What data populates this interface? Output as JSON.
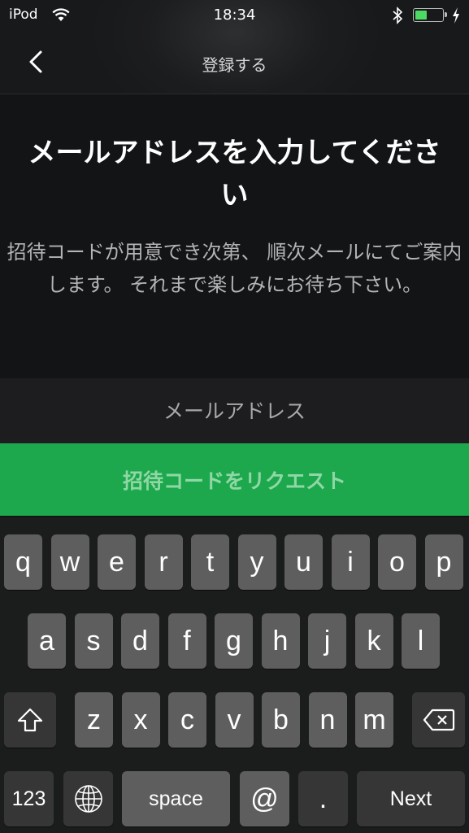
{
  "status_bar": {
    "carrier": "iPod",
    "time": "18:34",
    "battery_level_pct": 45,
    "icons": [
      "wifi-icon",
      "bluetooth-icon",
      "battery-icon",
      "charging-bolt-icon"
    ]
  },
  "nav": {
    "back_icon": "chevron-left-icon",
    "title": "登録する"
  },
  "content": {
    "heading": "メールアドレスを入力してください",
    "description": "招待コードが用意でき次第、 順次メールにてご案内します。 それまで楽しみにお待ち下さい。"
  },
  "form": {
    "email_value": "",
    "email_placeholder": "メールアドレス",
    "request_button_label": "招待コードをリクエスト"
  },
  "colors": {
    "accent_green": "#1ea84d",
    "battery_green": "#4cd964"
  },
  "keyboard": {
    "row1": [
      "q",
      "w",
      "e",
      "r",
      "t",
      "y",
      "u",
      "i",
      "o",
      "p"
    ],
    "row2": [
      "a",
      "s",
      "d",
      "f",
      "g",
      "h",
      "j",
      "k",
      "l"
    ],
    "row3": [
      "z",
      "x",
      "c",
      "v",
      "b",
      "n",
      "m"
    ],
    "shift_icon": "shift-icon",
    "delete_icon": "backspace-icon",
    "numbers_label": "123",
    "globe_icon": "globe-icon",
    "space_label": "space",
    "at_label": "@",
    "dot_label": ".",
    "next_label": "Next"
  }
}
